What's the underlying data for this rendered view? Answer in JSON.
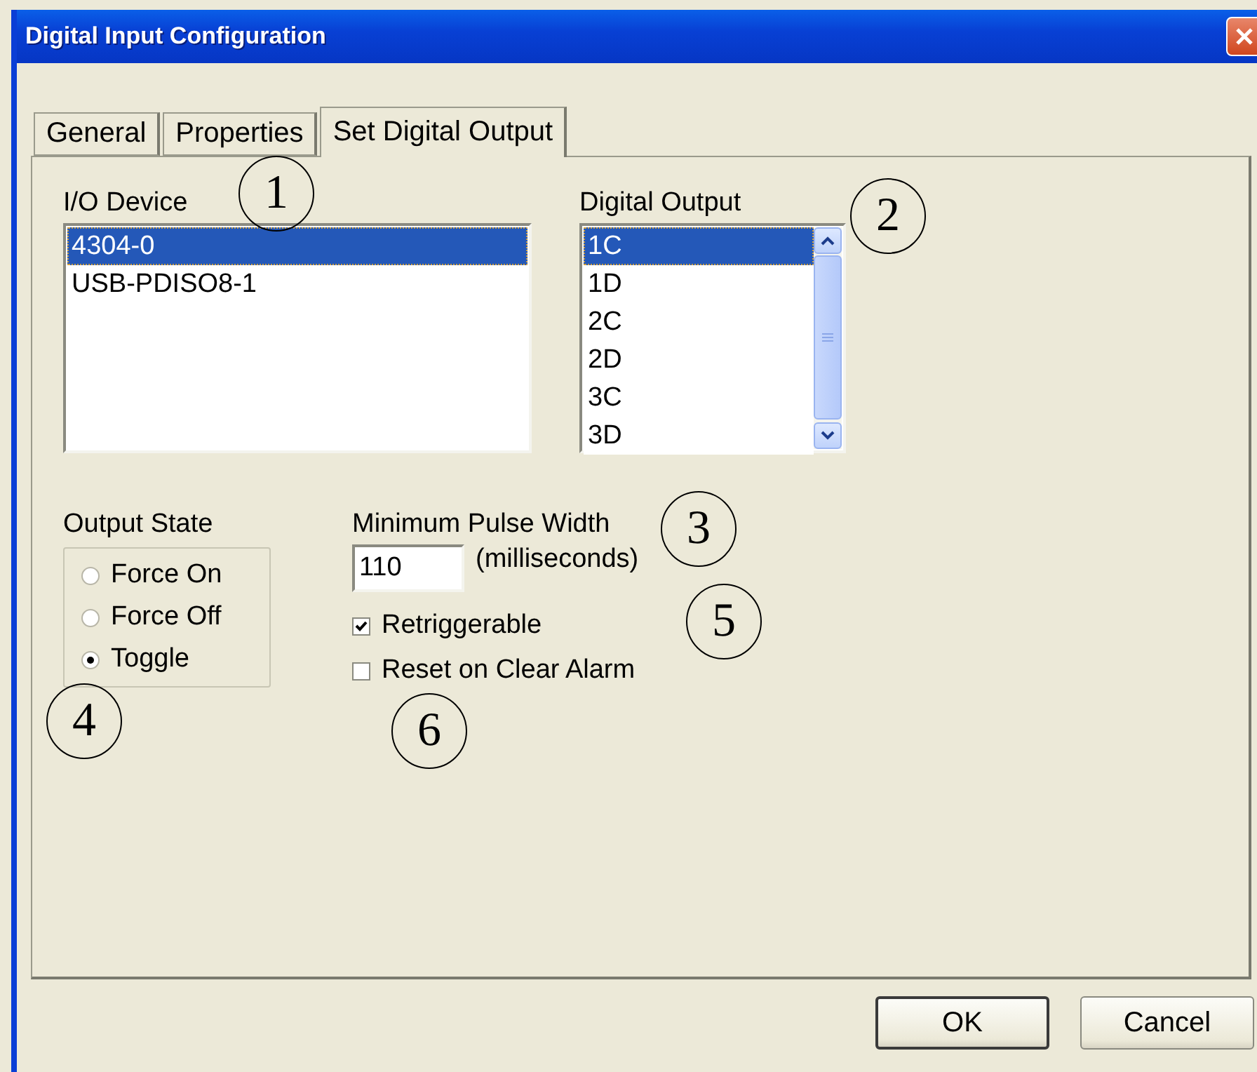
{
  "window": {
    "title": "Digital Input Configuration"
  },
  "tabs": [
    {
      "label": "General",
      "selected": false
    },
    {
      "label": "Properties",
      "selected": false
    },
    {
      "label": "Set Digital Output",
      "selected": true
    }
  ],
  "io_device": {
    "label": "I/O Device",
    "items": [
      {
        "label": "4304-0",
        "selected": true
      },
      {
        "label": "USB-PDISO8-1",
        "selected": false
      }
    ]
  },
  "digital_output": {
    "label": "Digital Output",
    "items": [
      {
        "label": "1C",
        "selected": true
      },
      {
        "label": "1D",
        "selected": false
      },
      {
        "label": "2C",
        "selected": false
      },
      {
        "label": "2D",
        "selected": false
      },
      {
        "label": "3C",
        "selected": false
      },
      {
        "label": "3D",
        "selected": false
      }
    ]
  },
  "output_state": {
    "label": "Output State",
    "options": [
      {
        "label": "Force On",
        "selected": false
      },
      {
        "label": "Force Off",
        "selected": false
      },
      {
        "label": "Toggle",
        "selected": true
      }
    ]
  },
  "pulse_width": {
    "label": "Minimum Pulse Width",
    "value": "110",
    "unit": "(milliseconds)"
  },
  "checkboxes": [
    {
      "label": "Retriggerable",
      "checked": true
    },
    {
      "label": "Reset on Clear Alarm",
      "checked": false
    }
  ],
  "callouts": [
    {
      "label": "1"
    },
    {
      "label": "2"
    },
    {
      "label": "3"
    },
    {
      "label": "4"
    },
    {
      "label": "5"
    },
    {
      "label": "6"
    }
  ],
  "buttons": [
    {
      "label": "OK",
      "default": true
    },
    {
      "label": "Cancel",
      "default": false
    }
  ]
}
